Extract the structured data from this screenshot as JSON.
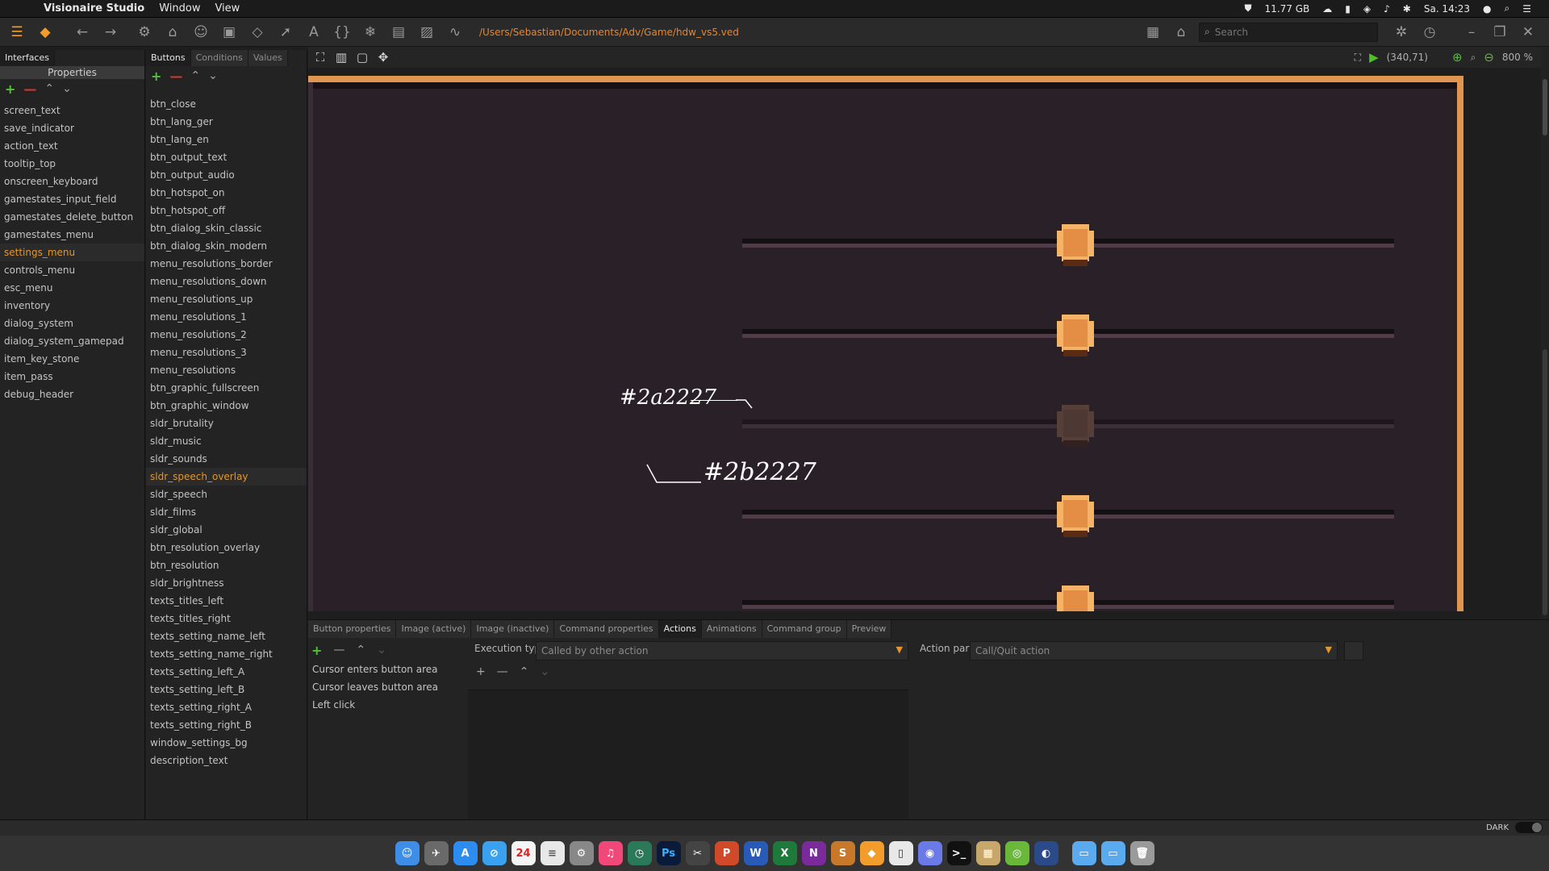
{
  "menubar": {
    "app_name": "Visionaire Studio",
    "items": [
      "Window",
      "View"
    ],
    "memory": "11.77 GB",
    "clock": "Sa. 14:23"
  },
  "toolbar": {
    "file_path": "/Users/Sebastian/Documents/Adv/Game/hdw_vs5.ved",
    "search_placeholder": "Search"
  },
  "interfaces_panel": {
    "tabs": [
      "Interfaces"
    ],
    "header": "Properties",
    "items": [
      "screen_text",
      "save_indicator",
      "action_text",
      "tooltip_top",
      "onscreen_keyboard",
      "gamestates_input_field",
      "gamestates_delete_button",
      "gamestates_menu",
      "settings_menu",
      "controls_menu",
      "esc_menu",
      "inventory",
      "dialog_system",
      "dialog_system_gamepad",
      "item_key_stone",
      "item_pass",
      "debug_header"
    ],
    "selected_index": 8
  },
  "buttons_panel": {
    "tabs": [
      "Buttons",
      "Conditions",
      "Values"
    ],
    "items": [
      "btn_close",
      "btn_lang_ger",
      "btn_lang_en",
      "btn_output_text",
      "btn_output_audio",
      "btn_hotspot_on",
      "btn_hotspot_off",
      "btn_dialog_skin_classic",
      "btn_dialog_skin_modern",
      "menu_resolutions_border",
      "menu_resolutions_down",
      "menu_resolutions_up",
      "menu_resolutions_1",
      "menu_resolutions_2",
      "menu_resolutions_3",
      "menu_resolutions",
      "btn_graphic_fullscreen",
      "btn_graphic_window",
      "sldr_brutality",
      "sldr_music",
      "sldr_sounds",
      "sldr_speech_overlay",
      "sldr_speech",
      "sldr_films",
      "sldr_global",
      "btn_resolution_overlay",
      "btn_resolution",
      "sldr_brightness",
      "texts_titles_left",
      "texts_titles_right",
      "texts_setting_name_left",
      "texts_setting_name_right",
      "texts_setting_left_A",
      "texts_setting_left_B",
      "texts_setting_right_A",
      "texts_setting_right_B",
      "window_settings_bg",
      "description_text"
    ],
    "selected_index": 21
  },
  "canvas": {
    "cursor_coords": "(340,71)",
    "zoom": "800 %",
    "annotation_1": "#2a2227",
    "annotation_2": "#2b2227",
    "colors": {
      "bg": "#2a2028",
      "frame": "#e09650",
      "knob": "#f5b366",
      "track_light": "#4e3c48"
    }
  },
  "bottom_panel": {
    "tabs": [
      "Button properties",
      "Image (active)",
      "Image (inactive)",
      "Command properties",
      "Actions",
      "Animations",
      "Command group",
      "Preview"
    ],
    "active_tab": "Actions",
    "events": [
      "Cursor enters button area",
      "Cursor leaves button area",
      "Left click"
    ],
    "execution_type_label": "Execution type",
    "execution_type_value": "Called by other action",
    "action_part_label": "Action part",
    "action_part_value": "Call/Quit action"
  },
  "statusbar": {
    "dark_label": "DARK"
  }
}
